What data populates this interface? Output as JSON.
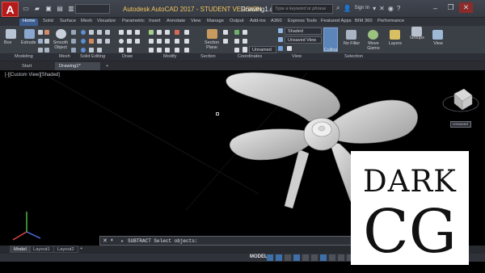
{
  "titlebar": {
    "logo_letter": "A",
    "workspace": "",
    "app_title": "Autodesk AutoCAD 2017 - STUDENT VERSION",
    "file_title": "Drawing1.dwg",
    "search_placeholder": "Type a keyword or phrase",
    "signin_label": "Sign In",
    "colors": {
      "accent": "#3b5d8f",
      "logo": "#b51b1b",
      "title": "#f3c75f"
    }
  },
  "ribbon_tabs": [
    "Home",
    "Solid",
    "Surface",
    "Mesh",
    "Visualize",
    "Parametric",
    "Insert",
    "Annotate",
    "View",
    "Manage",
    "Output",
    "Add-ins",
    "A360",
    "Express Tools",
    "Featured Apps",
    "BIM 360",
    "Performance"
  ],
  "ribbon": {
    "box_label": "Box",
    "extrude_label": "Extrude",
    "smooth_label": "Smooth\nObject",
    "section_plane_label": "Section\nPlane",
    "visual_style": "Shaded",
    "view_dropdown": "Unsaved View",
    "layer_dropdown": "Unnamed",
    "culling_label": "Culling",
    "nofilter_label": "No Filter",
    "gizmo_label": "Move\nGizmo",
    "layers_label": "Layers",
    "groups_label": "Groups",
    "view_label": "View",
    "panels": [
      "Modeling",
      "Mesh",
      "Solid Editing",
      "Draw",
      "Modify",
      "Section",
      "Coordinates",
      "View",
      "Selection"
    ]
  },
  "file_tabs": {
    "start": "Start",
    "drawing": "Drawing1*",
    "add": "+"
  },
  "viewport": {
    "label": "[-][Custom View][Shaded]",
    "viewcube_label": "Unsaved"
  },
  "command": {
    "close_icon": "close-icon",
    "text": "SUBTRACT Select objects:"
  },
  "layout_tabs": [
    "Model",
    "Layout1",
    "Layout2"
  ],
  "status": {
    "model_label": "MODEL"
  },
  "watermark": {
    "line1": "DARK",
    "line2": "CG"
  }
}
